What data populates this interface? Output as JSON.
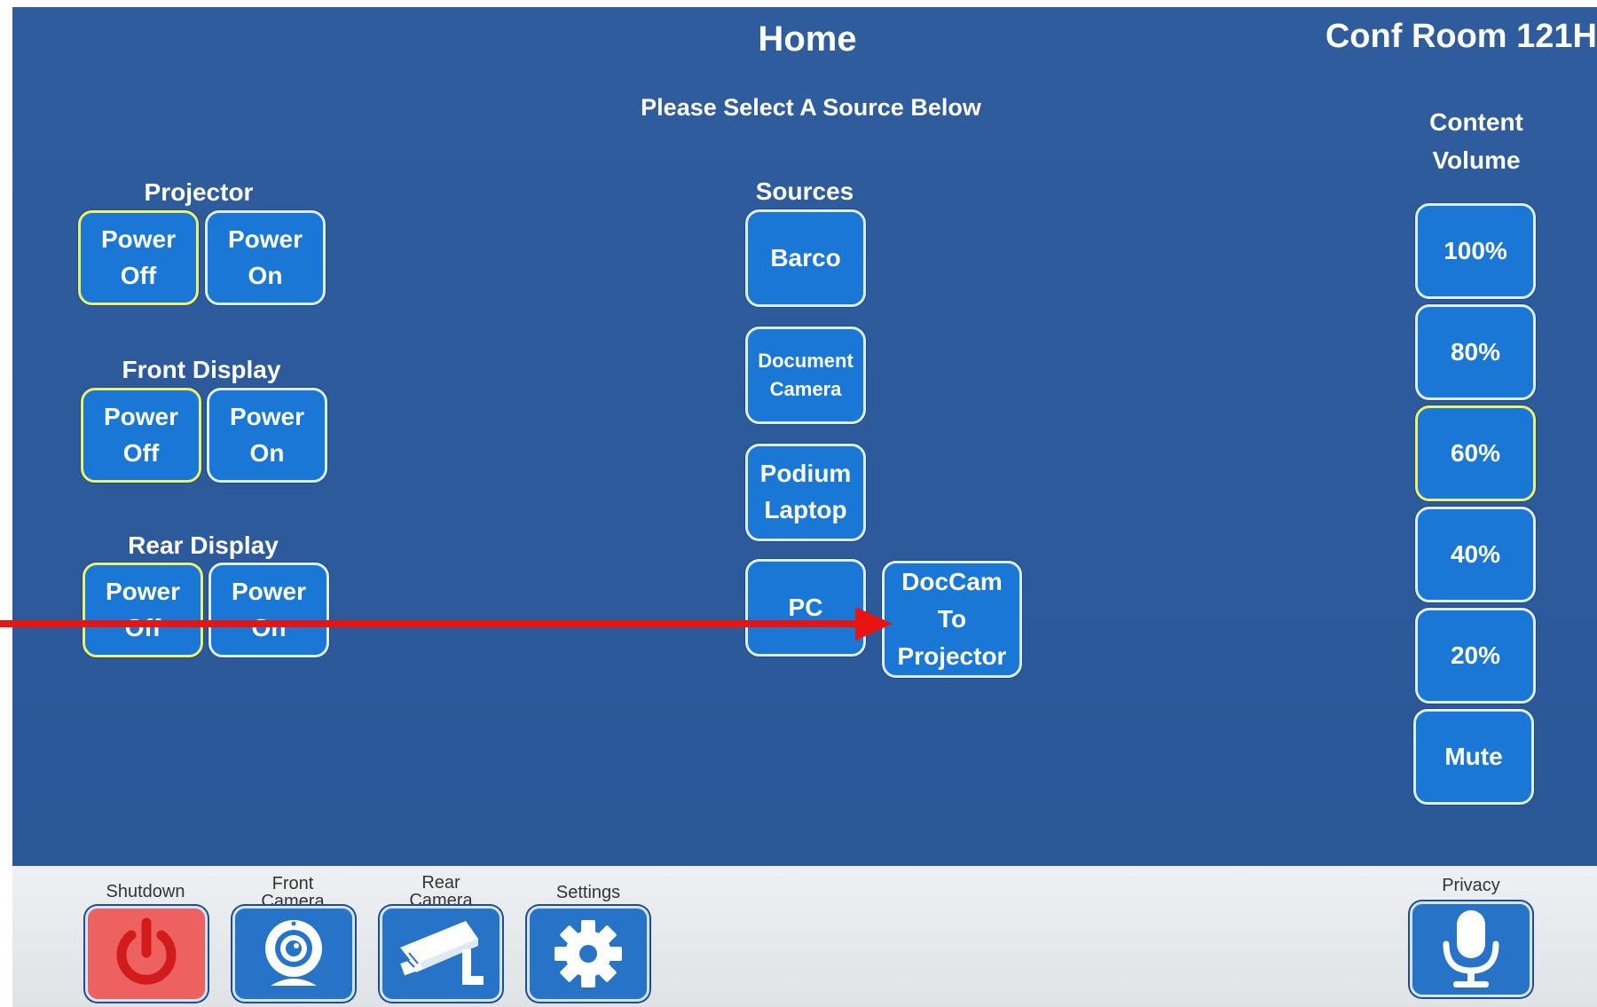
{
  "header": {
    "title": "Home",
    "room": "Conf Room 121H",
    "subtitle": "Please Select A Source Below"
  },
  "projector": {
    "label": "Projector",
    "power_off": "Power\nOff",
    "power_on": "Power\nOn"
  },
  "front_display": {
    "label": "Front Display",
    "power_off": "Power\nOff",
    "power_on": "Power\nOn"
  },
  "rear_display": {
    "label": "Rear Display",
    "power_off": "Power\nOff",
    "power_on": "Power\nOn"
  },
  "sources": {
    "label": "Sources",
    "barco": "Barco",
    "document_camera": "Document\nCamera",
    "podium_laptop": "Podium\nLaptop",
    "pc": "PC",
    "doccam_to_projector": "DocCam\nTo\nProjector"
  },
  "volume": {
    "label": "Content\nVolume",
    "levels": [
      "100%",
      "80%",
      "60%",
      "40%",
      "20%"
    ],
    "selected": "60%",
    "mute": "Mute"
  },
  "bottom_bar": {
    "shutdown": "Shutdown",
    "front_camera": "Front\nCamera",
    "rear_camera": "Rear\nCamera",
    "settings": "Settings",
    "privacy": "Privacy"
  },
  "icons": {
    "shutdown": "power-icon",
    "front_camera": "webcam-icon",
    "rear_camera": "security-camera-icon",
    "settings": "gear-icon",
    "privacy": "microphone-icon"
  },
  "colors": {
    "background": "#2d5a9a",
    "button": "#1a77d6",
    "button_border": "#dfeeff",
    "active_border": "#eef26a",
    "annotation_arrow": "#e8140f",
    "shutdown_button": "#ee6161"
  }
}
